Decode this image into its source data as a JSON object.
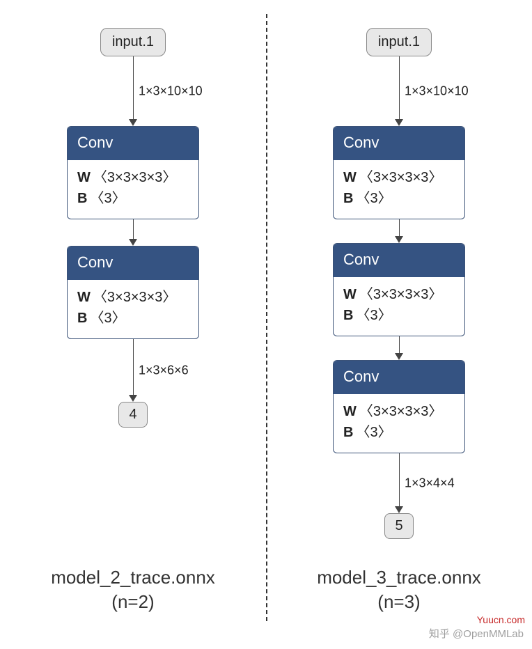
{
  "left": {
    "input": "input.1",
    "edge_in": "1×3×10×10",
    "convs": [
      {
        "title": "Conv",
        "w": "〈3×3×3×3〉",
        "b": "〈3〉"
      },
      {
        "title": "Conv",
        "w": "〈3×3×3×3〉",
        "b": "〈3〉"
      }
    ],
    "edge_out": "1×3×6×6",
    "output": "4",
    "caption_line1": "model_2_trace.onnx",
    "caption_line2": "(n=2)"
  },
  "right": {
    "input": "input.1",
    "edge_in": "1×3×10×10",
    "convs": [
      {
        "title": "Conv",
        "w": "〈3×3×3×3〉",
        "b": "〈3〉"
      },
      {
        "title": "Conv",
        "w": "〈3×3×3×3〉",
        "b": "〈3〉"
      },
      {
        "title": "Conv",
        "w": "〈3×3×3×3〉",
        "b": "〈3〉"
      }
    ],
    "edge_out": "1×3×4×4",
    "output": "5",
    "caption_line1": "model_3_trace.onnx",
    "caption_line2": "(n=3)"
  },
  "watermark_r": "Yuucn.com",
  "watermark_z": "知乎 @OpenMMLab"
}
